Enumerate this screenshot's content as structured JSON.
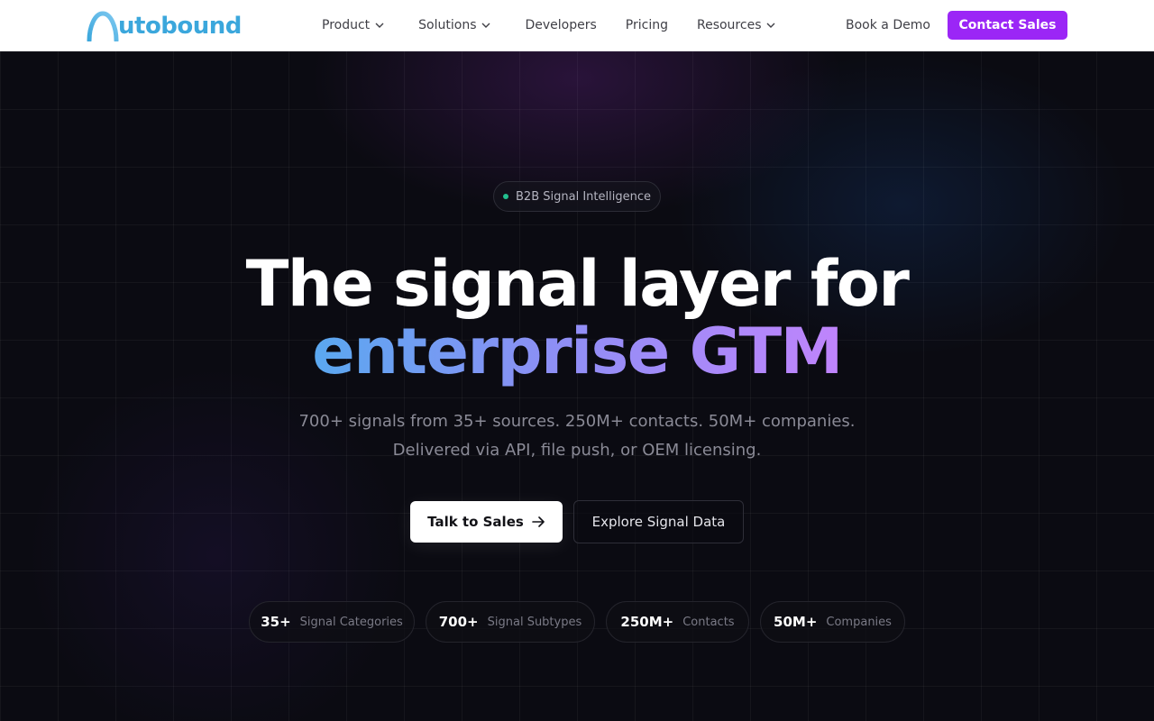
{
  "nav": {
    "logo_text": "utobound",
    "logo_word": "Autobound",
    "links": [
      {
        "label": "Product",
        "has_dropdown": true
      },
      {
        "label": "Solutions",
        "has_dropdown": true
      },
      {
        "label": "Developers",
        "has_dropdown": false
      },
      {
        "label": "Pricing",
        "has_dropdown": false
      },
      {
        "label": "Resources",
        "has_dropdown": true
      }
    ],
    "book_demo": "Book a Demo",
    "contact_sales": "Contact Sales"
  },
  "hero": {
    "badge": "B2B Signal Intelligence",
    "headline_line1": "The signal layer for",
    "headline_line2": "enterprise GTM",
    "subtitle_line1": "700+ signals from 35+ sources. 250M+ contacts. 50M+ companies.",
    "subtitle_line2": "Delivered via API, file push, or OEM licensing.",
    "primary_button": "Talk to Sales",
    "secondary_button": "Explore Signal Data",
    "stats": [
      {
        "value": "35+",
        "label": "Signal Categories"
      },
      {
        "value": "700+",
        "label": "Signal Subtypes"
      },
      {
        "value": "250M+",
        "label": "Contacts"
      },
      {
        "value": "50M+",
        "label": "Companies"
      }
    ]
  },
  "colors": {
    "brand_purple": "#9b26f6",
    "logo_blue": "#3ba7dc",
    "badge_dot_green": "#22c08e",
    "gradient_start": "#5aa8f0",
    "gradient_end": "#c084fc",
    "hero_background": "#0b0b12"
  },
  "icons": {
    "dropdown": "chevron-down-icon",
    "talk_to_sales": "arrow-right-icon",
    "logo_mark": "arch-logo-icon",
    "badge": "status-dot-icon"
  }
}
